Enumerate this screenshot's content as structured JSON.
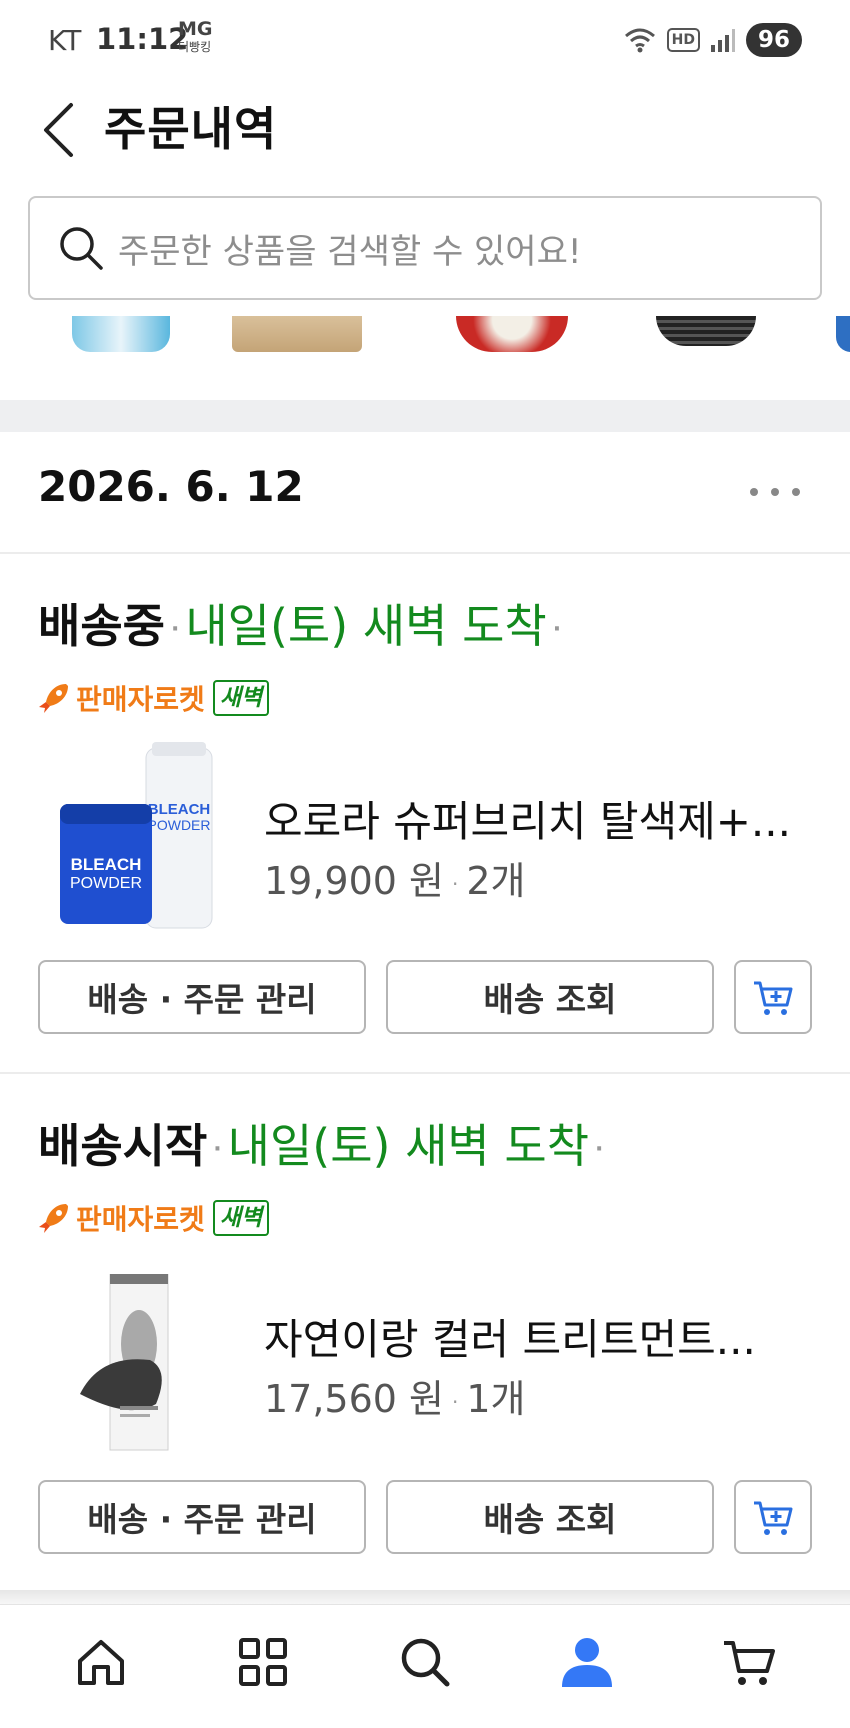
{
  "status_bar": {
    "carrier": "KT",
    "time": "11:12",
    "mg_label": "MG",
    "mg_sub": "더빵킹",
    "hd_label": "HD",
    "battery": "96"
  },
  "header": {
    "title": "주문내역",
    "back_icon": "chevron-left-icon"
  },
  "search": {
    "placeholder": "주문한 상품을 검색할 수 있어요!",
    "icon": "search-icon"
  },
  "order_group": {
    "date": "2026. 6. 12",
    "more_icon": "more-horizontal-icon"
  },
  "orders": [
    {
      "status": "배송중",
      "arrival": "내일(토) 새벽 도착",
      "rocket_label": "판매자로켓",
      "dawn_badge": "새벽",
      "product_name": "오로라 슈퍼브리치 탈색제+...",
      "price": "19,900 원",
      "quantity": "2개",
      "image_text_top": "BLEACH",
      "image_text_bottom": "POWDER",
      "manage_label": "배송 · 주문 관리",
      "track_label": "배송 조회",
      "cart_icon": "cart-plus-icon"
    },
    {
      "status": "배송시작",
      "arrival": "내일(토) 새벽 도착",
      "rocket_label": "판매자로켓",
      "dawn_badge": "새벽",
      "product_name": "자연이랑 컬러 트리트먼트...",
      "price": "17,560 원",
      "quantity": "1개",
      "manage_label": "배송 · 주문 관리",
      "track_label": "배송 조회",
      "cart_icon": "cart-plus-icon"
    }
  ],
  "bottom_nav": {
    "items": [
      "home-icon",
      "categories-icon",
      "search-icon",
      "my-account-icon",
      "cart-icon"
    ],
    "active": "my-account-icon",
    "active_color": "#3478f6"
  },
  "colors": {
    "arrival_green": "#138a1e",
    "rocket_orange": "#f07b17"
  }
}
